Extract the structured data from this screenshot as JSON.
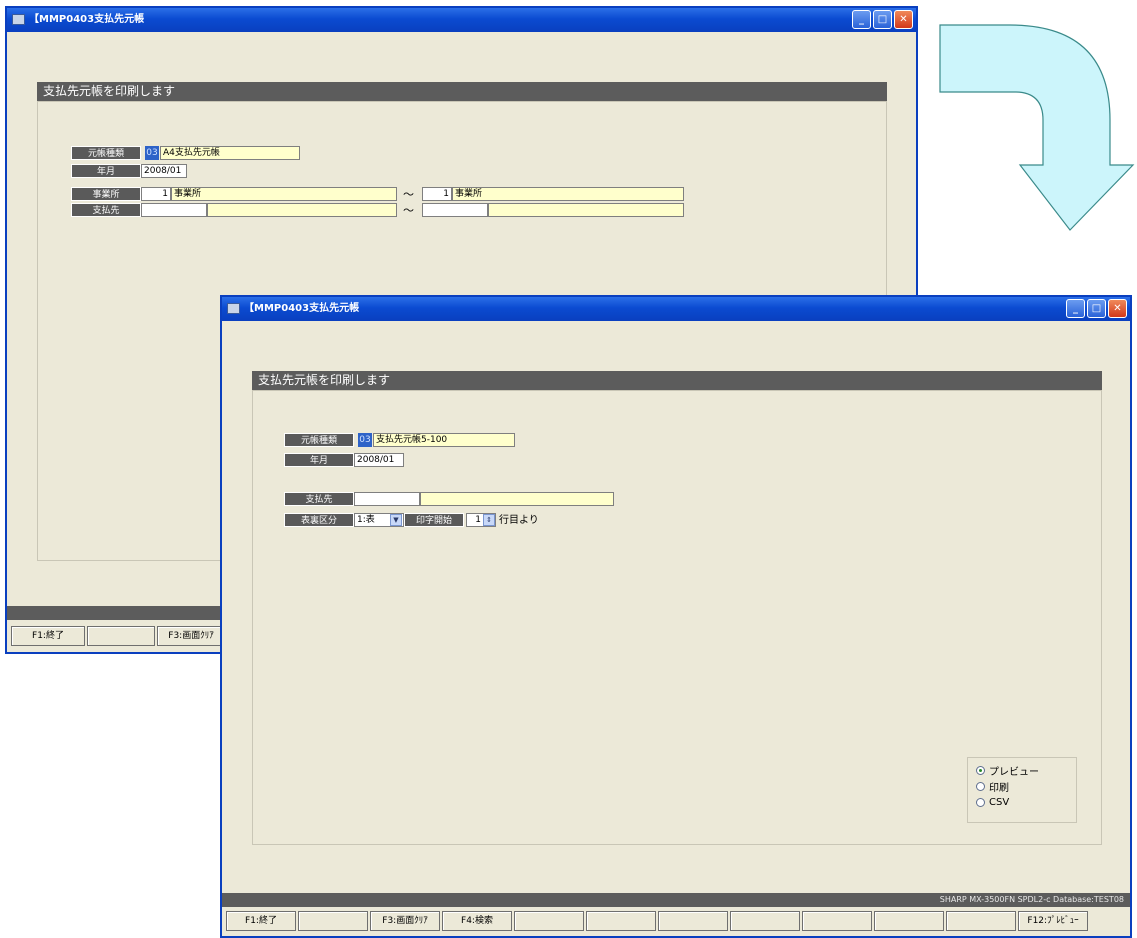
{
  "window1": {
    "title": "【MMP0403支払先元帳",
    "banner": "支払先元帳を印刷します",
    "fields": {
      "ledger_type_label": "元帳種類",
      "ledger_type_code": "03",
      "ledger_type_value": "A4支払先元帳",
      "year_month_label": "年月",
      "year_month_value": "2008/01",
      "office_label": "事業所",
      "office_from_code": "1",
      "office_from_name": "事業所",
      "office_to_code": "1",
      "office_to_name": "事業所",
      "payee_label": "支払先",
      "range_sep": "～"
    },
    "fkeys": [
      "F1:終了",
      "",
      "F3:画面ｸﾘｱ"
    ]
  },
  "window2": {
    "title": "【MMP0403支払先元帳",
    "banner": "支払先元帳を印刷します",
    "fields": {
      "ledger_type_label": "元帳種類",
      "ledger_type_code": "03",
      "ledger_type_value": "支払先元帳5-100",
      "year_month_label": "年月",
      "year_month_value": "2008/01",
      "payee_label": "支払先",
      "print_side_label": "表裏区分",
      "print_side_value": "1:表",
      "start_row_label": "印字開始",
      "start_row_value": "1",
      "start_row_suffix": "行目より"
    },
    "output": {
      "options": [
        "プレビュー",
        "印刷",
        "CSV"
      ],
      "selected": "プレビュー"
    },
    "status_text": "SHARP MX-3500FN SPDL2-c   Database:TEST08",
    "fkeys": [
      "F1:終了",
      "",
      "F3:画面ｸﾘｱ",
      "F4:検索",
      "",
      "",
      "",
      "",
      "",
      "",
      "",
      "F12:ﾌﾟﾚﾋﾞｭｰ"
    ]
  },
  "colors": {
    "arrow_fill": "#ccf5fb",
    "titlebar": "#0b4bd1",
    "window_bg": "#ece9d8",
    "input_yellow": "#ffffcc"
  }
}
